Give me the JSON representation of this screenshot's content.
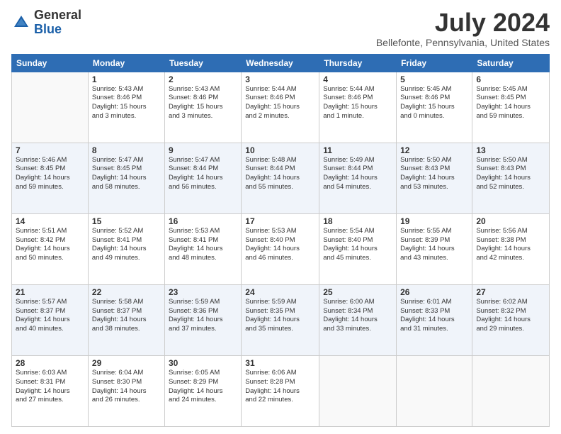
{
  "logo": {
    "general": "General",
    "blue": "Blue"
  },
  "header": {
    "month": "July 2024",
    "location": "Bellefonte, Pennsylvania, United States"
  },
  "weekdays": [
    "Sunday",
    "Monday",
    "Tuesday",
    "Wednesday",
    "Thursday",
    "Friday",
    "Saturday"
  ],
  "weeks": [
    [
      {
        "day": "",
        "info": ""
      },
      {
        "day": "1",
        "info": "Sunrise: 5:43 AM\nSunset: 8:46 PM\nDaylight: 15 hours\nand 3 minutes."
      },
      {
        "day": "2",
        "info": "Sunrise: 5:43 AM\nSunset: 8:46 PM\nDaylight: 15 hours\nand 3 minutes."
      },
      {
        "day": "3",
        "info": "Sunrise: 5:44 AM\nSunset: 8:46 PM\nDaylight: 15 hours\nand 2 minutes."
      },
      {
        "day": "4",
        "info": "Sunrise: 5:44 AM\nSunset: 8:46 PM\nDaylight: 15 hours\nand 1 minute."
      },
      {
        "day": "5",
        "info": "Sunrise: 5:45 AM\nSunset: 8:46 PM\nDaylight: 15 hours\nand 0 minutes."
      },
      {
        "day": "6",
        "info": "Sunrise: 5:45 AM\nSunset: 8:45 PM\nDaylight: 14 hours\nand 59 minutes."
      }
    ],
    [
      {
        "day": "7",
        "info": "Sunrise: 5:46 AM\nSunset: 8:45 PM\nDaylight: 14 hours\nand 59 minutes."
      },
      {
        "day": "8",
        "info": "Sunrise: 5:47 AM\nSunset: 8:45 PM\nDaylight: 14 hours\nand 58 minutes."
      },
      {
        "day": "9",
        "info": "Sunrise: 5:47 AM\nSunset: 8:44 PM\nDaylight: 14 hours\nand 56 minutes."
      },
      {
        "day": "10",
        "info": "Sunrise: 5:48 AM\nSunset: 8:44 PM\nDaylight: 14 hours\nand 55 minutes."
      },
      {
        "day": "11",
        "info": "Sunrise: 5:49 AM\nSunset: 8:44 PM\nDaylight: 14 hours\nand 54 minutes."
      },
      {
        "day": "12",
        "info": "Sunrise: 5:50 AM\nSunset: 8:43 PM\nDaylight: 14 hours\nand 53 minutes."
      },
      {
        "day": "13",
        "info": "Sunrise: 5:50 AM\nSunset: 8:43 PM\nDaylight: 14 hours\nand 52 minutes."
      }
    ],
    [
      {
        "day": "14",
        "info": "Sunrise: 5:51 AM\nSunset: 8:42 PM\nDaylight: 14 hours\nand 50 minutes."
      },
      {
        "day": "15",
        "info": "Sunrise: 5:52 AM\nSunset: 8:41 PM\nDaylight: 14 hours\nand 49 minutes."
      },
      {
        "day": "16",
        "info": "Sunrise: 5:53 AM\nSunset: 8:41 PM\nDaylight: 14 hours\nand 48 minutes."
      },
      {
        "day": "17",
        "info": "Sunrise: 5:53 AM\nSunset: 8:40 PM\nDaylight: 14 hours\nand 46 minutes."
      },
      {
        "day": "18",
        "info": "Sunrise: 5:54 AM\nSunset: 8:40 PM\nDaylight: 14 hours\nand 45 minutes."
      },
      {
        "day": "19",
        "info": "Sunrise: 5:55 AM\nSunset: 8:39 PM\nDaylight: 14 hours\nand 43 minutes."
      },
      {
        "day": "20",
        "info": "Sunrise: 5:56 AM\nSunset: 8:38 PM\nDaylight: 14 hours\nand 42 minutes."
      }
    ],
    [
      {
        "day": "21",
        "info": "Sunrise: 5:57 AM\nSunset: 8:37 PM\nDaylight: 14 hours\nand 40 minutes."
      },
      {
        "day": "22",
        "info": "Sunrise: 5:58 AM\nSunset: 8:37 PM\nDaylight: 14 hours\nand 38 minutes."
      },
      {
        "day": "23",
        "info": "Sunrise: 5:59 AM\nSunset: 8:36 PM\nDaylight: 14 hours\nand 37 minutes."
      },
      {
        "day": "24",
        "info": "Sunrise: 5:59 AM\nSunset: 8:35 PM\nDaylight: 14 hours\nand 35 minutes."
      },
      {
        "day": "25",
        "info": "Sunrise: 6:00 AM\nSunset: 8:34 PM\nDaylight: 14 hours\nand 33 minutes."
      },
      {
        "day": "26",
        "info": "Sunrise: 6:01 AM\nSunset: 8:33 PM\nDaylight: 14 hours\nand 31 minutes."
      },
      {
        "day": "27",
        "info": "Sunrise: 6:02 AM\nSunset: 8:32 PM\nDaylight: 14 hours\nand 29 minutes."
      }
    ],
    [
      {
        "day": "28",
        "info": "Sunrise: 6:03 AM\nSunset: 8:31 PM\nDaylight: 14 hours\nand 27 minutes."
      },
      {
        "day": "29",
        "info": "Sunrise: 6:04 AM\nSunset: 8:30 PM\nDaylight: 14 hours\nand 26 minutes."
      },
      {
        "day": "30",
        "info": "Sunrise: 6:05 AM\nSunset: 8:29 PM\nDaylight: 14 hours\nand 24 minutes."
      },
      {
        "day": "31",
        "info": "Sunrise: 6:06 AM\nSunset: 8:28 PM\nDaylight: 14 hours\nand 22 minutes."
      },
      {
        "day": "",
        "info": ""
      },
      {
        "day": "",
        "info": ""
      },
      {
        "day": "",
        "info": ""
      }
    ]
  ]
}
